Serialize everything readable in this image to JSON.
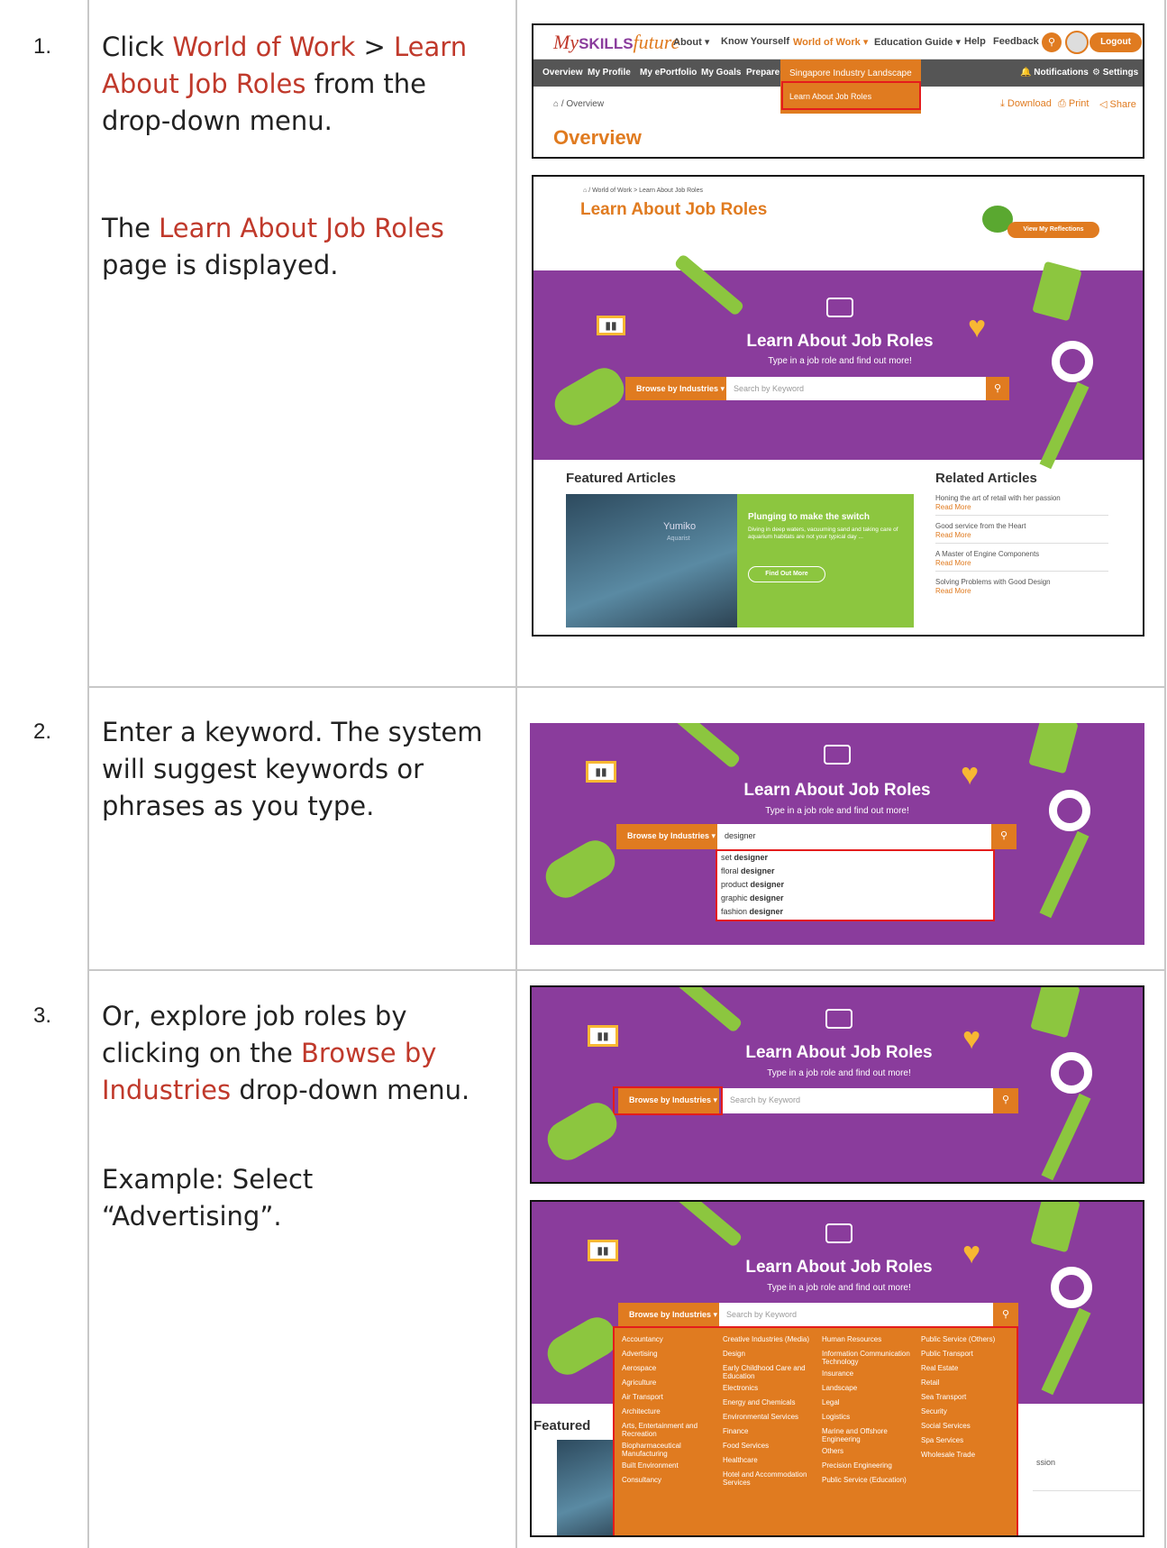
{
  "steps": [
    {
      "num": "1.",
      "text_a": "Click ",
      "hl1": "World of Work",
      "sep": " > ",
      "hl2": "Learn About Job Roles",
      "text_b": " from the drop-down menu.",
      "result_hl": "Learn About Job Roles",
      "result_rest": " page is displayed.",
      "result_pre": "The "
    },
    {
      "num": "2.",
      "text": "Enter a keyword. The system will suggest keywords or phrases as you type."
    },
    {
      "num": "3.",
      "text_a": "Or, explore job roles by clicking on the ",
      "hl": "Browse by Industries",
      "text_b": " drop-down menu.",
      "example": "Example: Select “Advertising”."
    }
  ],
  "site": {
    "logo_my": "My",
    "logo_skills": "SKILLS",
    "logo_future": "future",
    "nav": [
      "About",
      "Know Yourself",
      "World of Work",
      "Education Guide",
      "Help",
      "Feedback"
    ],
    "logout": "Logout",
    "subnav": [
      "Overview",
      "My Profile",
      "My ePortfolio",
      "My Goals",
      "Prepare f"
    ],
    "notifications": "Notifications",
    "settings": "Settings",
    "dropdown": [
      "Singapore Industry Landscape",
      "Learn About Job Roles"
    ],
    "crumb_overview": "/ Overview",
    "toolbar": [
      "Download",
      "Print",
      "Share"
    ],
    "overview_title": "Overview"
  },
  "jobroles": {
    "crumb": "/ World of Work > Learn About Job Roles",
    "title": "Learn About Job Roles",
    "reflections": "View My Reflections",
    "hero_title": "Learn About Job Roles",
    "hero_sub": "Type in a job role and find out more!",
    "browse": "Browse by Industries",
    "search_placeholder": "Search by Keyword",
    "search_typed": "designer",
    "featured": "Featured Articles",
    "featured_short": "Featured",
    "related": "Related Articles",
    "card_title": "Plunging to make the switch",
    "card_body": "Diving in deep waters, vacuuming sand and taking care of aquarium habitats are not your typical day ...",
    "card_btn": "Find Out More",
    "card_name": "Yumiko",
    "card_role": "Aquarist",
    "related_items": [
      "Honing the art of retail with her passion",
      "Good service from the Heart",
      "A Master of Engine Components",
      "Solving Problems with Good Design"
    ],
    "read_more": "Read More",
    "ssion": "ssion"
  },
  "suggestions": [
    {
      "pre": "set ",
      "bold": "designer"
    },
    {
      "pre": "floral ",
      "bold": "designer"
    },
    {
      "pre": "product ",
      "bold": "designer"
    },
    {
      "pre": "graphic ",
      "bold": "designer"
    },
    {
      "pre": "fashion ",
      "bold": "designer"
    }
  ],
  "industries": {
    "col1": [
      "Accountancy",
      "Advertising",
      "Aerospace",
      "Agriculture",
      "Air Transport",
      "Architecture",
      "Arts, Entertainment and Recreation",
      "Biopharmaceutical Manufacturing",
      "Built Environment",
      "Consultancy"
    ],
    "col2": [
      "Creative Industries (Media)",
      "Design",
      "Early Childhood Care and Education",
      "Electronics",
      "Energy and Chemicals",
      "Environmental Services",
      "Finance",
      "Food Services",
      "Healthcare",
      "Hotel and Accommodation Services"
    ],
    "col3": [
      "Human Resources",
      "Information Communication Technology",
      "Insurance",
      "Landscape",
      "Legal",
      "Logistics",
      "Marine and Offshore Engineering",
      "Others",
      "Precision Engineering",
      "Public Service (Education)"
    ],
    "col4": [
      "Public Service (Others)",
      "Public Transport",
      "Real Estate",
      "Retail",
      "Sea Transport",
      "Security",
      "Social Services",
      "Spa Services",
      "Wholesale Trade"
    ]
  }
}
